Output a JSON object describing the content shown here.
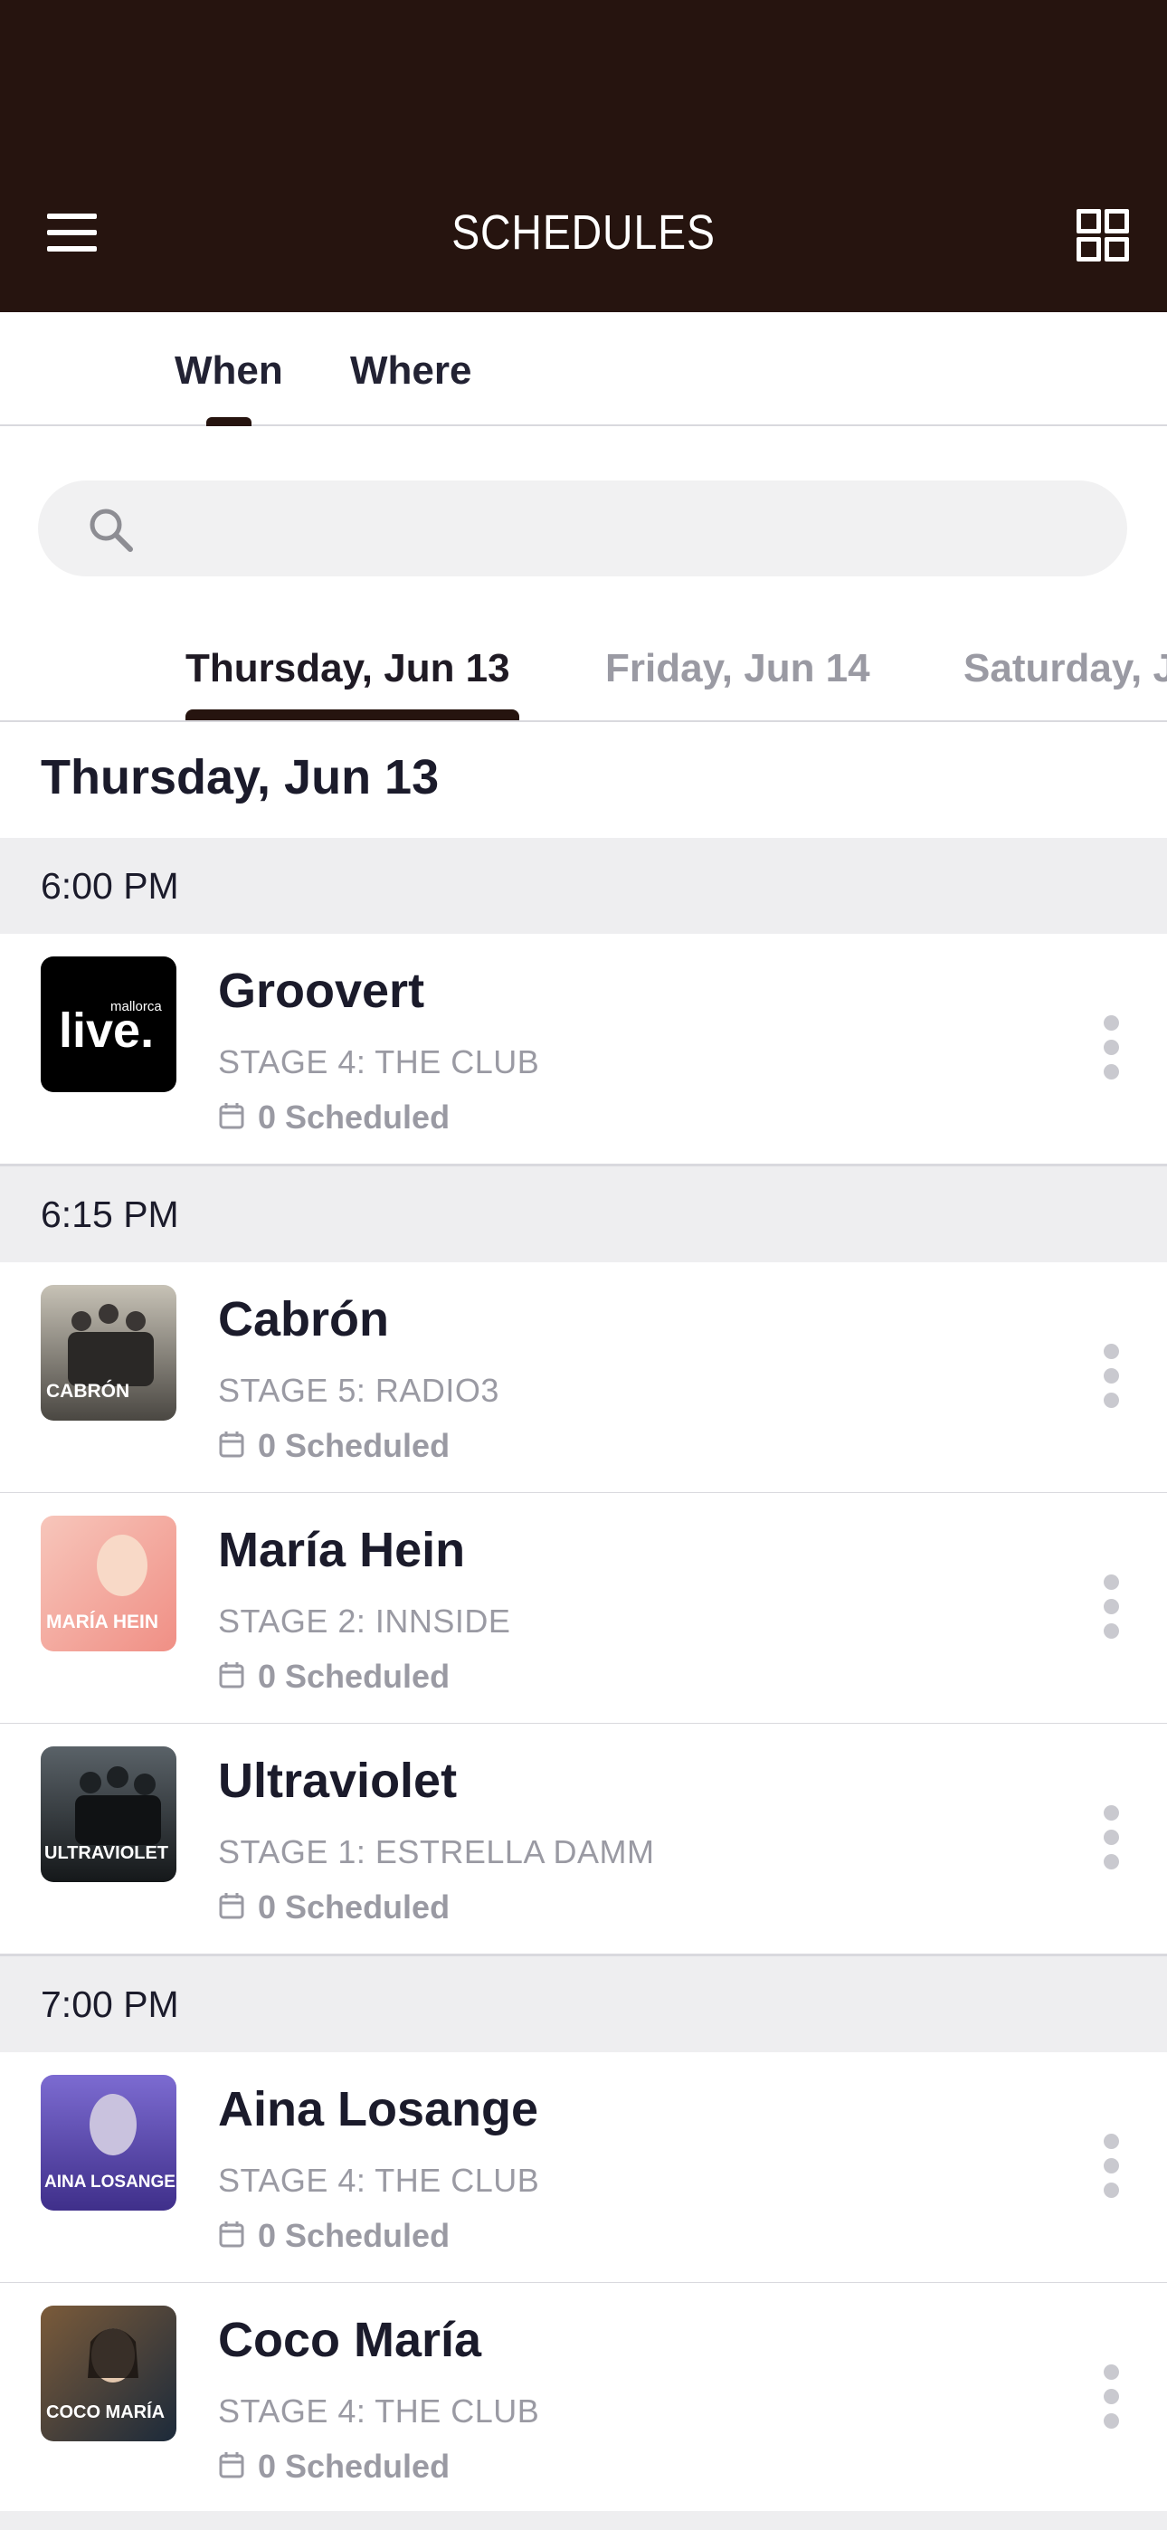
{
  "header": {
    "title": "SCHEDULES",
    "menu_icon": "hamburger-menu-icon",
    "view_icon": "grid-view-icon",
    "background": "#26140f"
  },
  "tabs": [
    {
      "label": "When",
      "active": true
    },
    {
      "label": "Where",
      "active": false
    }
  ],
  "search": {
    "placeholder": "",
    "icon": "search-icon"
  },
  "days": [
    {
      "label": "Thursday, Jun 13",
      "active": true
    },
    {
      "label": "Friday, Jun 14",
      "active": false
    },
    {
      "label": "Saturday, J",
      "active": false
    }
  ],
  "section": {
    "date": "Thursday, Jun 13"
  },
  "time_slots": [
    {
      "time": "6:00 PM"
    },
    {
      "time": "6:15 PM"
    },
    {
      "time": "7:00 PM"
    }
  ],
  "events": [
    {
      "name": "Groovert",
      "stage": "STAGE 4: THE CLUB",
      "scheduled": "0 Scheduled",
      "thumb_logo_small": "mallorca",
      "thumb_logo_big": "live.",
      "thumb_colors": [
        "#000000",
        "#000000"
      ]
    },
    {
      "name": "Cabrón",
      "stage": "STAGE 5: RADIO3",
      "scheduled": "0 Scheduled",
      "thumb_caption": "CABRÓN",
      "thumb_colors": [
        "#c7c2b6",
        "#4a4742"
      ]
    },
    {
      "name": "María Hein",
      "stage": "STAGE 2: INNSIDE",
      "scheduled": "0 Scheduled",
      "thumb_caption": "MARÍA HEIN",
      "thumb_colors": [
        "#f7c6bb",
        "#f08f85"
      ]
    },
    {
      "name": "Ultraviolet",
      "stage": "STAGE 1: ESTRELLA DAMM",
      "scheduled": "0 Scheduled",
      "thumb_caption": "ULTRAVIOLET",
      "thumb_colors": [
        "#5a6268",
        "#15181a"
      ]
    },
    {
      "name": "Aina Losange",
      "stage": "STAGE 4: THE CLUB",
      "scheduled": "0 Scheduled",
      "thumb_caption": "AINA LOSANGE",
      "thumb_colors": [
        "#7c6bd1",
        "#3f2f8a"
      ]
    },
    {
      "name": "Coco María",
      "stage": "STAGE 4: THE CLUB",
      "scheduled": "0 Scheduled",
      "thumb_caption": "COCO MARÍA",
      "thumb_colors": [
        "#7b5b3a",
        "#1c2a3a"
      ]
    }
  ]
}
